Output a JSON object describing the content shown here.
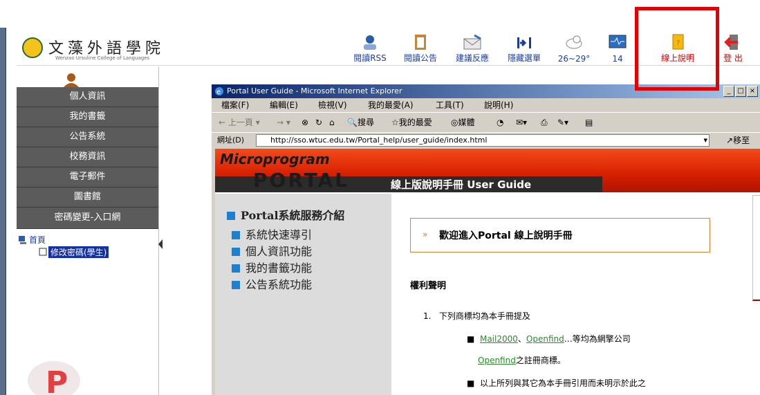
{
  "portal": {
    "school_name": "文藻外語學院",
    "school_name_en": "Wenzao Ursuline College of Languages",
    "toolbar": [
      {
        "label": "閱讀RSS",
        "icon": "rss-person-icon"
      },
      {
        "label": "閱讀公告",
        "icon": "clipboard-icon"
      },
      {
        "label": "建議反應",
        "icon": "envelope-icon"
      },
      {
        "label": "隱藏選單",
        "icon": "hide-menu-icon"
      },
      {
        "label": "26~29°",
        "icon": "weather-cloud-icon"
      },
      {
        "label": "14",
        "icon": "monitor-icon"
      },
      {
        "label": "線上說明",
        "icon": "help-book-icon"
      },
      {
        "label": "登 出",
        "icon": "logout-arrow-icon"
      }
    ],
    "menu": [
      "個人資訊",
      "我的書籤",
      "公告系統",
      "校務資訊",
      "電子郵件",
      "圖書館",
      "密碼變更-入口網"
    ],
    "tree": {
      "root": "首頁",
      "child": "修改密碼(學生)"
    },
    "highlight_color": "#e40000"
  },
  "ie": {
    "title": "Portal User Guide - Microsoft Internet Explorer",
    "menubar": [
      "檔案(F)",
      "編輯(E)",
      "檢視(V)",
      "我的最愛(A)",
      "工具(T)",
      "說明(H)"
    ],
    "toolbar": [
      "上一頁",
      "搜尋",
      "我的最愛",
      "媒體"
    ],
    "address_label": "網址(D)",
    "address": "http://sso.wtuc.edu.tw/Portal_help/user_guide/index.html",
    "go_label": "移至"
  },
  "page": {
    "banner_top": "Microprogram",
    "banner_main": "PORTAL",
    "banner_sub": "線上版說明手冊 User Guide",
    "nav": [
      "Portal系統服務介紹",
      "系統快速導引",
      "個人資訊功能",
      "我的書籤功能",
      "公告系統功能"
    ],
    "welcome": "歡迎進入Portal 線上說明手冊",
    "rights_heading": "權利聲明",
    "item1": "下列商標均為本手冊提及",
    "link1": "Mail2000",
    "sep": "、",
    "link2": "Openfind",
    "sub1_rest": "…等均為網擎公司",
    "link3": "Openfind",
    "sub1b_rest": "之註冊商標。",
    "sub2": "以上所列與其它為本手冊引用而未明示於此之"
  }
}
